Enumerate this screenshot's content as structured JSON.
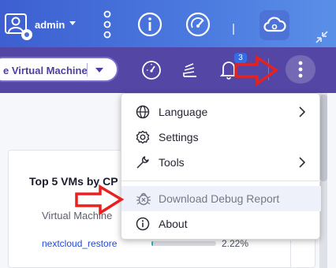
{
  "topbar": {
    "user_name": "admin",
    "icons": [
      "user-admin-icon",
      "more-vertical-icon",
      "info-icon",
      "dashboard-speed-icon",
      "cloud-icon",
      "collapse-icon"
    ]
  },
  "header": {
    "vm_selector_label": "e Virtual Machine",
    "notification_count": "3",
    "icons": [
      "resource-monitor-icon",
      "tasks-stack-icon",
      "notifications-icon",
      "more-menu-icon"
    ]
  },
  "panel": {
    "title": "Top 5 VMs by CP",
    "column_header": "Virtual Machine",
    "rows": [
      {
        "name": "nextcloud_restore",
        "usage_text": "2.22%",
        "usage_fraction": 0.0222
      }
    ]
  },
  "menu": {
    "items": [
      {
        "label": "Language",
        "icon": "globe-icon",
        "has_submenu": true
      },
      {
        "label": "Settings",
        "icon": "gear-icon",
        "has_submenu": false
      },
      {
        "label": "Tools",
        "icon": "wrench-icon",
        "has_submenu": true
      },
      {
        "label": "Download Debug Report",
        "icon": "bug-icon",
        "has_submenu": false
      },
      {
        "label": "About",
        "icon": "info-icon",
        "has_submenu": false
      }
    ]
  },
  "annotations": {
    "arrow_color": "#e8201e"
  }
}
